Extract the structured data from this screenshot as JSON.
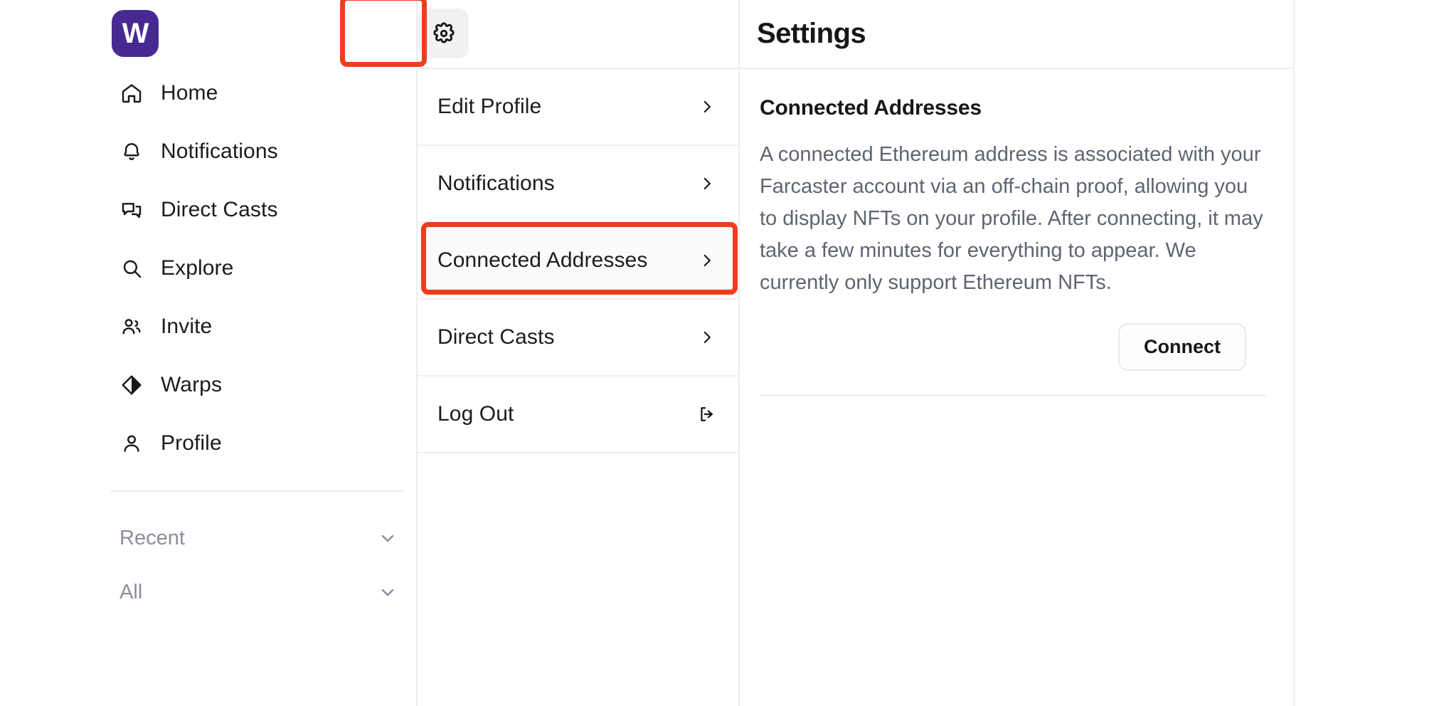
{
  "app": {
    "logo_letter": "W",
    "accent_purple": "#472a91",
    "annotation_red": "#f03c1e"
  },
  "sidebar": {
    "items": [
      {
        "label": "Home",
        "icon": "home-icon"
      },
      {
        "label": "Notifications",
        "icon": "bell-icon"
      },
      {
        "label": "Direct Casts",
        "icon": "chat-bubbles-icon"
      },
      {
        "label": "Explore",
        "icon": "search-icon"
      },
      {
        "label": "Invite",
        "icon": "users-icon"
      },
      {
        "label": "Warps",
        "icon": "diamond-icon"
      },
      {
        "label": "Profile",
        "icon": "person-icon"
      }
    ],
    "sections": [
      {
        "label": "Recent",
        "icon": "chevron-down-icon"
      },
      {
        "label": "All",
        "icon": "chevron-down-icon"
      }
    ]
  },
  "settings": {
    "title": "Settings",
    "gear_icon": "gear-icon",
    "menu": [
      {
        "label": "Edit Profile",
        "icon": "chevron-right-icon",
        "highlighted": false
      },
      {
        "label": "Notifications",
        "icon": "chevron-right-icon",
        "highlighted": false
      },
      {
        "label": "Connected Addresses",
        "icon": "chevron-right-icon",
        "highlighted": true
      },
      {
        "label": "Direct Casts",
        "icon": "chevron-right-icon",
        "highlighted": false
      },
      {
        "label": "Log Out",
        "icon": "logout-icon",
        "highlighted": false
      }
    ]
  },
  "detail": {
    "title": "Connected Addresses",
    "description": "A connected Ethereum address is associated with your Farcaster account via an off-chain proof, allowing you to display NFTs on your profile. After connecting, it may take a few minutes for everything to appear. We currently only support Ethereum NFTs.",
    "connect_label": "Connect"
  }
}
